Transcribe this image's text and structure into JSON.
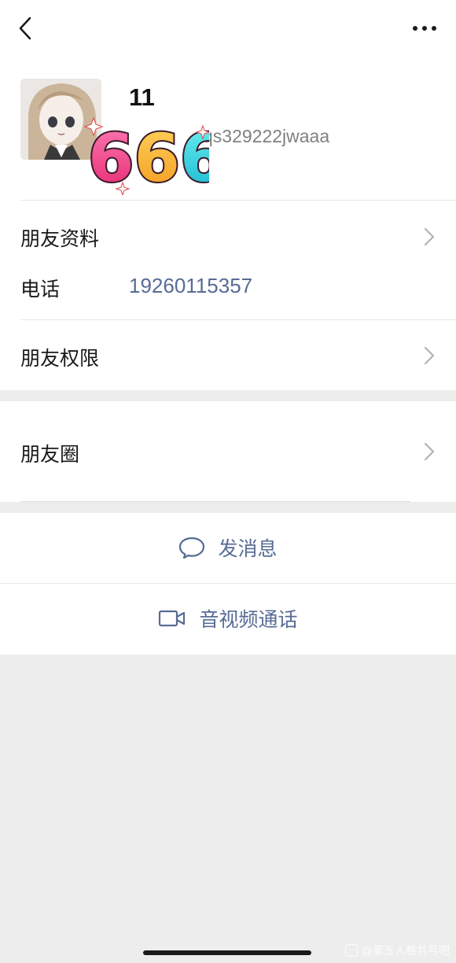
{
  "header": {
    "back_icon": "chevron-left-icon",
    "more_icon": "more-horizontal-icon"
  },
  "profile": {
    "display_name": "11",
    "wechat_id": "qs329222jwaaa",
    "sticker_text": "666"
  },
  "rows": {
    "friend_profile_label": "朋友资料",
    "phone_label": "电话",
    "phone_value": "19260115357",
    "friend_permissions_label": "朋友权限",
    "moments_label": "朋友圈"
  },
  "actions": {
    "message_label": "发消息",
    "message_icon": "chat-bubble-icon",
    "call_label": "音视频通话",
    "call_icon": "video-camera-icon"
  },
  "watermark": {
    "text": "@第五人格共号吧"
  },
  "colors": {
    "link_blue": "#576b95",
    "background": "#ededed",
    "surface": "#ffffff"
  }
}
